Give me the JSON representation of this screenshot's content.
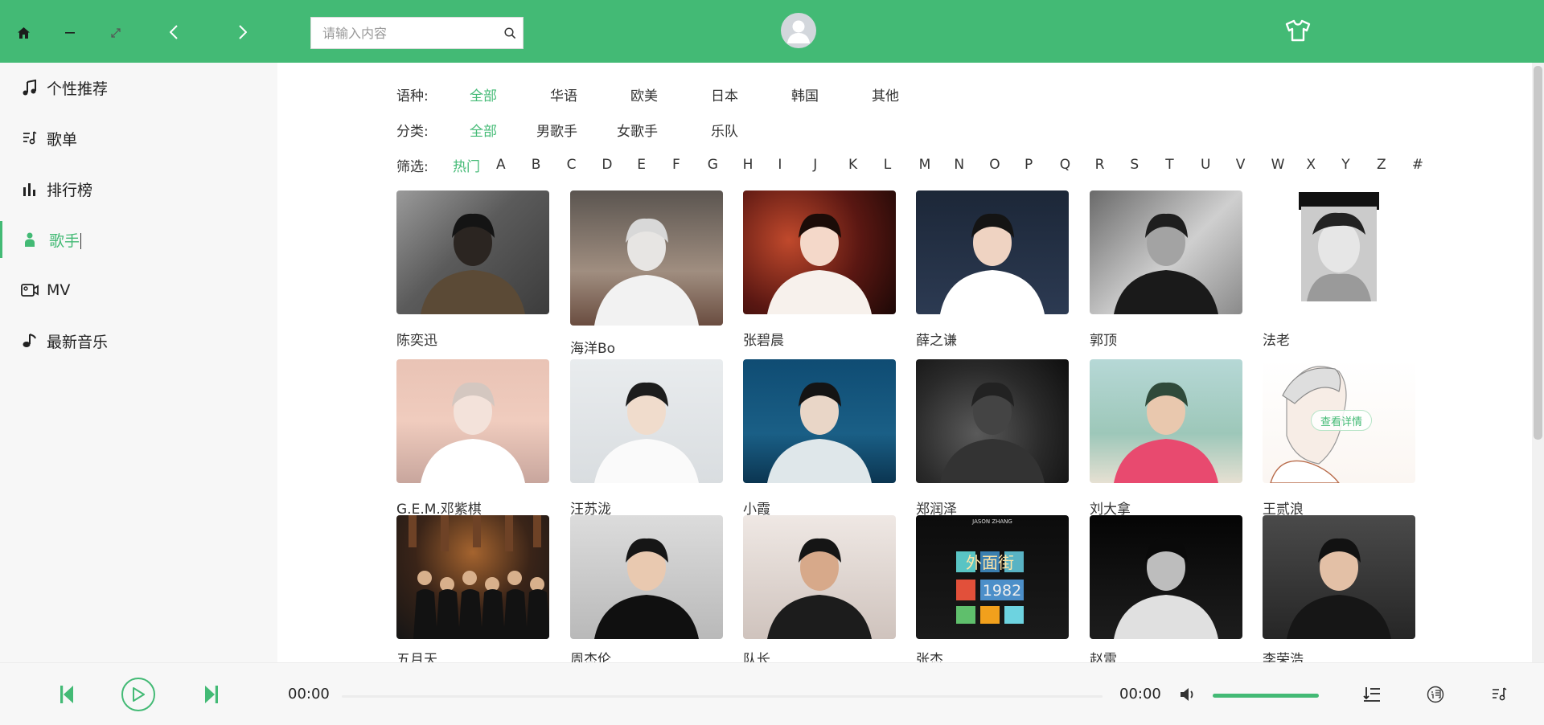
{
  "search": {
    "placeholder": "请输入内容"
  },
  "colors": {
    "accent": "#43ba75",
    "header": "#43ba75",
    "sidebar": "#f7f7f7"
  },
  "sidebar": {
    "items": [
      {
        "label": "个性推荐",
        "icon": "music-note-icon"
      },
      {
        "label": "歌单",
        "icon": "playlist-icon"
      },
      {
        "label": "排行榜",
        "icon": "bar-chart-icon"
      },
      {
        "label": "歌手",
        "icon": "person-icon",
        "active": true
      },
      {
        "label": "MV",
        "icon": "video-camera-icon"
      },
      {
        "label": "最新音乐",
        "icon": "music-note-small-icon"
      }
    ]
  },
  "filters": {
    "language": {
      "label": "语种:",
      "options": [
        "全部",
        "华语",
        "欧美",
        "日本",
        "韩国",
        "其他"
      ],
      "selected": 0
    },
    "category": {
      "label": "分类:",
      "options": [
        "全部",
        "男歌手",
        "女歌手",
        "乐队"
      ],
      "selected": 0
    },
    "letter": {
      "label": "筛选:",
      "options": [
        "热门",
        "A",
        "B",
        "C",
        "D",
        "E",
        "F",
        "G",
        "H",
        "I",
        "J",
        "K",
        "L",
        "M",
        "N",
        "O",
        "P",
        "Q",
        "R",
        "S",
        "T",
        "U",
        "V",
        "W",
        "X",
        "Y",
        "Z",
        "#"
      ],
      "selected": 0
    }
  },
  "artists": [
    {
      "name": "陈奕迅"
    },
    {
      "name": "海洋Bo"
    },
    {
      "name": "张碧晨"
    },
    {
      "name": "薛之谦"
    },
    {
      "name": "郭顶"
    },
    {
      "name": "法老"
    },
    {
      "name": "G.E.M.邓紫棋"
    },
    {
      "name": "汪苏泷"
    },
    {
      "name": "小霞"
    },
    {
      "name": "郑润泽"
    },
    {
      "name": "刘大拿"
    },
    {
      "name": "王贰浪"
    },
    {
      "name": "五月天"
    },
    {
      "name": "周杰伦"
    },
    {
      "name": "队长"
    },
    {
      "name": "张杰"
    },
    {
      "name": "赵雷"
    },
    {
      "name": "李荣浩"
    }
  ],
  "hover_overlay": {
    "label": "查看详情"
  },
  "album_text": {
    "brand": "JASON ZHANG",
    "title": "外面街",
    "year": "1982"
  },
  "player": {
    "current_time": "00:00",
    "total_time": "00:00",
    "volume": 1.0,
    "progress": 0.0
  }
}
